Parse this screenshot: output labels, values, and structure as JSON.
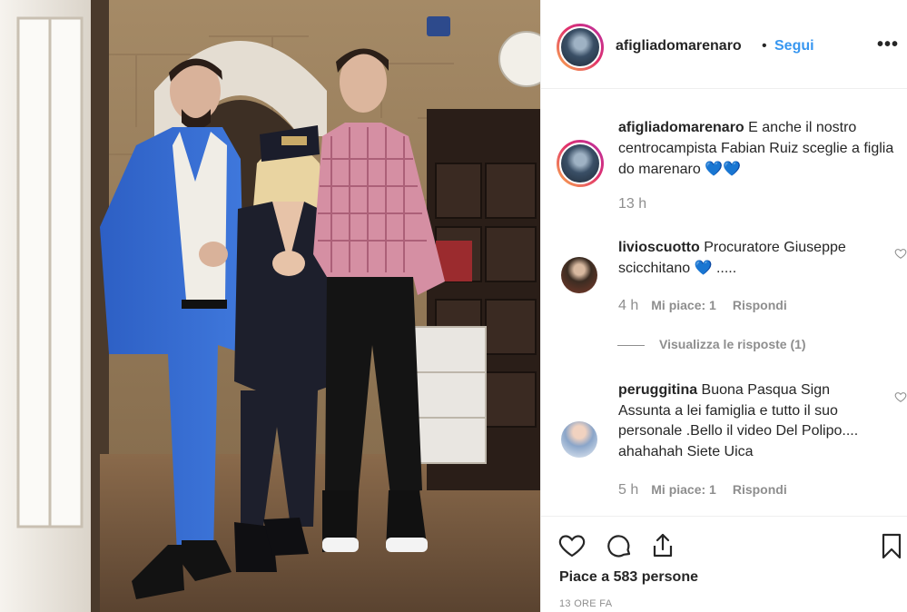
{
  "post": {
    "username": "afigliadomarenaro",
    "separator": "•",
    "follow_label": "Segui",
    "more_label": "•••"
  },
  "caption": {
    "username": "afigliadomarenaro",
    "text": " E anche il nostro centrocampista Fabian Ruiz sceglie a figlia do marenaro ",
    "emoji": "💙💙",
    "time": "13 h"
  },
  "comments": [
    {
      "username": "livioscuotto",
      "text": " Procuratore Giuseppe scicchitano ",
      "emoji": "💙",
      "tail": " .....",
      "time": "4 h",
      "likes": "Mi piace: 1",
      "reply": "Rispondi"
    },
    {
      "username": "peruggitina",
      "text": " Buona Pasqua Sign Assunta a lei famiglia e tutto il suo personale .Bello il video Del Polipo.... ahahahah Siete Uica",
      "time": "5 h",
      "likes": "Mi piace: 1",
      "reply": "Rispondi"
    }
  ],
  "view_replies": "Visualizza le risposte (1)",
  "likes_count": "Piace a 583 persone",
  "timestamp": "13 ORE FA",
  "colors": {
    "link": "#3897f0",
    "muted": "#8e8e8e",
    "text": "#262626",
    "border": "#efefef"
  },
  "icons": {
    "like": "heart-icon",
    "comment": "comment-icon",
    "share": "share-icon",
    "save": "bookmark-icon",
    "more": "more-options-icon"
  }
}
